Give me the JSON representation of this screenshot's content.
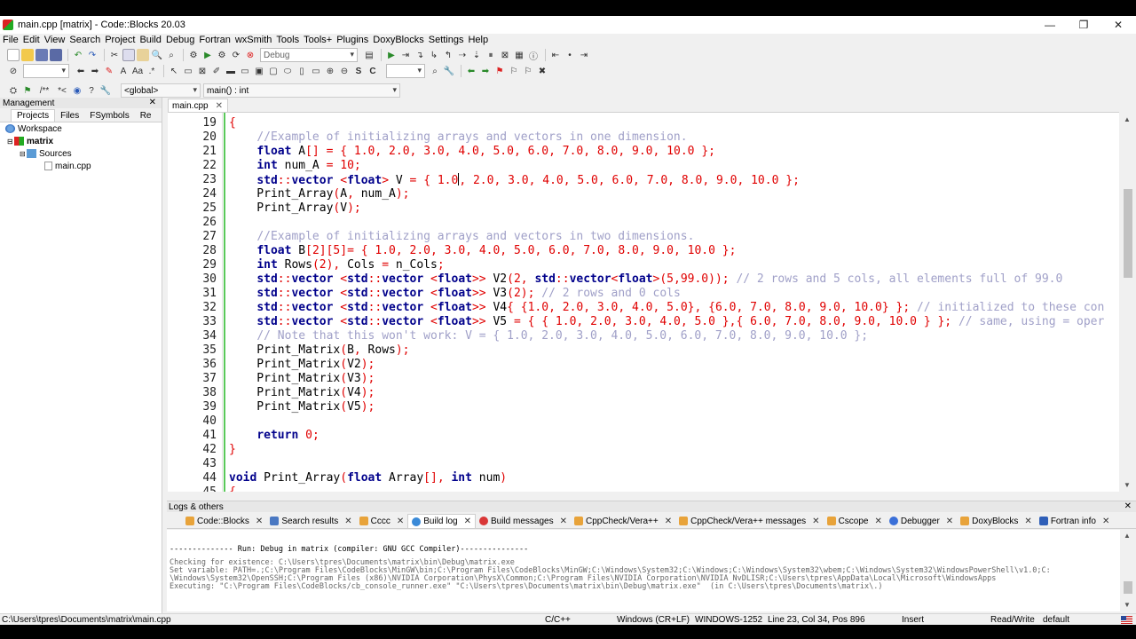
{
  "window": {
    "title": "main.cpp [matrix] - Code::Blocks 20.03",
    "controls": {
      "minimize": "—",
      "restore": "❐",
      "close": "✕"
    }
  },
  "menu": [
    "File",
    "Edit",
    "View",
    "Search",
    "Project",
    "Build",
    "Debug",
    "Fortran",
    "wxSmith",
    "Tools",
    "Tools+",
    "Plugins",
    "DoxyBlocks",
    "Settings",
    "Help"
  ],
  "toolbar": {
    "build_target": "Debug",
    "scope": "<global>",
    "function": "main() : int"
  },
  "management": {
    "title": "Management",
    "tabs": [
      "Projects",
      "Files",
      "FSymbols",
      "Re"
    ],
    "tree": {
      "workspace": "Workspace",
      "project": "matrix",
      "folder": "Sources",
      "file": "main.cpp"
    }
  },
  "editor": {
    "tab": "main.cpp",
    "lines": [
      {
        "n": "19"
      },
      {
        "n": "20"
      },
      {
        "n": "21"
      },
      {
        "n": "22"
      },
      {
        "n": "23"
      },
      {
        "n": "24"
      },
      {
        "n": "25"
      },
      {
        "n": "26"
      },
      {
        "n": "27"
      },
      {
        "n": "28"
      },
      {
        "n": "29"
      },
      {
        "n": "30"
      },
      {
        "n": "31"
      },
      {
        "n": "32"
      },
      {
        "n": "33"
      },
      {
        "n": "34"
      },
      {
        "n": "35"
      },
      {
        "n": "36"
      },
      {
        "n": "37"
      },
      {
        "n": "38"
      },
      {
        "n": "39"
      },
      {
        "n": "40"
      },
      {
        "n": "41"
      },
      {
        "n": "42"
      },
      {
        "n": "43"
      },
      {
        "n": "44"
      },
      {
        "n": "45"
      }
    ]
  },
  "logs": {
    "title": "Logs & others",
    "tabs": [
      {
        "label": "Code::Blocks",
        "color": "#e8a33a"
      },
      {
        "label": "Search results",
        "color": "#4a78c2"
      },
      {
        "label": "Cccc",
        "color": "#e8a33a"
      },
      {
        "label": "Build log",
        "color": "#3a8ad8"
      },
      {
        "label": "Build messages",
        "color": "#d93636"
      },
      {
        "label": "CppCheck/Vera++",
        "color": "#e8a33a"
      },
      {
        "label": "CppCheck/Vera++ messages",
        "color": "#e8a33a"
      },
      {
        "label": "Cscope",
        "color": "#e8a33a"
      },
      {
        "label": "Debugger",
        "color": "#3a6fd8"
      },
      {
        "label": "DoxyBlocks",
        "color": "#e8a33a"
      },
      {
        "label": "Fortran info",
        "color": "#2f5fb8"
      }
    ],
    "lines": [
      "-------------- Run: Debug in matrix (compiler: GNU GCC Compiler)---------------",
      "Checking for existence: C:\\Users\\tpres\\Documents\\matrix\\bin\\Debug\\matrix.exe",
      "Set variable: PATH=.;C:\\Program Files\\CodeBlocks\\MinGW\\bin;C:\\Program Files\\CodeBlocks\\MinGW;C:\\Windows\\System32;C:\\Windows;C:\\Windows\\System32\\wbem;C:\\Windows\\System32\\WindowsPowerShell\\v1.0;C:",
      "\\Windows\\System32\\OpenSSH;C:\\Program Files (x86)\\NVIDIA Corporation\\PhysX\\Common;C:\\Program Files\\NVIDIA Corporation\\NVIDIA NvDLISR;C:\\Users\\tpres\\AppData\\Local\\Microsoft\\WindowsApps",
      "Executing: \"C:\\Program Files\\CodeBlocks/cb_console_runner.exe\" \"C:\\Users\\tpres\\Documents\\matrix\\bin\\Debug\\matrix.exe\"  (in C:\\Users\\tpres\\Documents\\matrix\\.)"
    ]
  },
  "status": {
    "path": "C:\\Users\\tpres\\Documents\\matrix\\main.cpp",
    "language": "C/C++",
    "eol": "Windows (CR+LF)",
    "encoding": "WINDOWS-1252",
    "position": "Line 23, Col 34, Pos 896",
    "mode": "Insert",
    "access": "Read/Write",
    "profile": "default"
  },
  "colors": {
    "keyword": "#00008b",
    "number": "#e00000",
    "comment": "#a0a0c8",
    "fold": "#59c959"
  }
}
